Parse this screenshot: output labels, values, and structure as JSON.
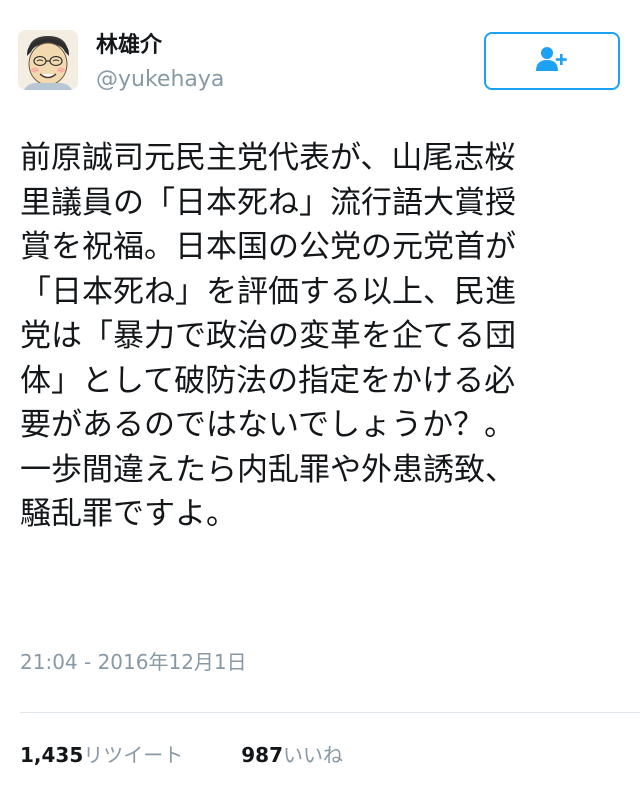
{
  "user": {
    "display_name": "林雄介",
    "username": "@yukehaya"
  },
  "follow_button": {
    "icon": "add-user-icon",
    "color": "#1da1f2"
  },
  "tweet": {
    "lines": [
      "前原誠司元民主党代表が、山尾志桜",
      "里議員の「日本死ね」流行語大賞授",
      "賞を祝福。日本国の公党の元党首が",
      "「日本死ね」を評価する以上、民進",
      "党は「暴力で政治の変革を企てる団",
      "体」として破防法の指定をかける必",
      "要があるのではないでしょうか？。",
      "一歩間違えたら内乱罪や外患誘致、",
      "騒乱罪ですよ。"
    ],
    "timestamp": "21:04 - 2016年12月1日"
  },
  "stats": {
    "retweets_count": "1,435",
    "retweets_label": "リツイート",
    "likes_count": "987",
    "likes_label": "いいね"
  },
  "colors": {
    "accent": "#1da1f2",
    "text": "#14171a",
    "muted": "#8899a6",
    "divider": "#e1e8ed"
  }
}
